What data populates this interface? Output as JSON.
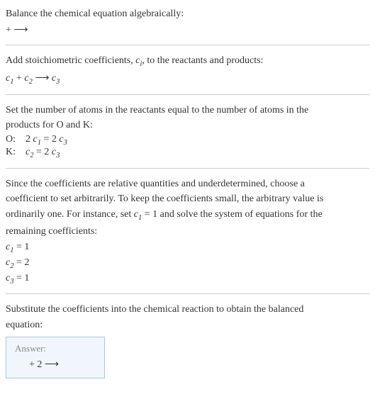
{
  "intro": {
    "line1": "Balance the chemical equation algebraically:",
    "reaction": " +  ⟶ "
  },
  "step1": {
    "text": "Add stoichiometric coefficients, ",
    "ci": "c",
    "ci_sub": "i",
    "text2": ", to the reactants and products:",
    "eq_c1": "c",
    "eq_c1_sub": "1",
    "eq_plus": " + ",
    "eq_c2": "c",
    "eq_c2_sub": "2",
    "eq_arrow": " ⟶ ",
    "eq_c3": "c",
    "eq_c3_sub": "3"
  },
  "step2": {
    "text1": "Set the number of atoms in the reactants equal to the number of atoms in the",
    "text2": "products for O and K:",
    "o_label": "O:",
    "o_eq_2": "2 ",
    "o_eq_c1": "c",
    "o_eq_c1_sub": "1",
    "o_eq_eq": " = 2 ",
    "o_eq_c3": "c",
    "o_eq_c3_sub": "3",
    "k_label": "K:",
    "k_eq_c2": "c",
    "k_eq_c2_sub": "2",
    "k_eq_eq": " = 2 ",
    "k_eq_c3": "c",
    "k_eq_c3_sub": "3"
  },
  "step3": {
    "text1": "Since the coefficients are relative quantities and underdetermined, choose a",
    "text2": "coefficient to set arbitrarily. To keep the coefficients small, the arbitrary value is",
    "text3a": "ordinarily one. For instance, set ",
    "text3_c1": "c",
    "text3_c1_sub": "1",
    "text3b": " = 1 and solve the system of equations for the",
    "text4": "remaining coefficients:",
    "r1_c": "c",
    "r1_sub": "1",
    "r1_val": " = 1",
    "r2_c": "c",
    "r2_sub": "2",
    "r2_val": " = 2",
    "r3_c": "c",
    "r3_sub": "3",
    "r3_val": " = 1"
  },
  "step4": {
    "text1": "Substitute the coefficients into the chemical reaction to obtain the balanced",
    "text2": "equation:"
  },
  "answer": {
    "label": "Answer:",
    "eq": " + 2  ⟶ "
  }
}
